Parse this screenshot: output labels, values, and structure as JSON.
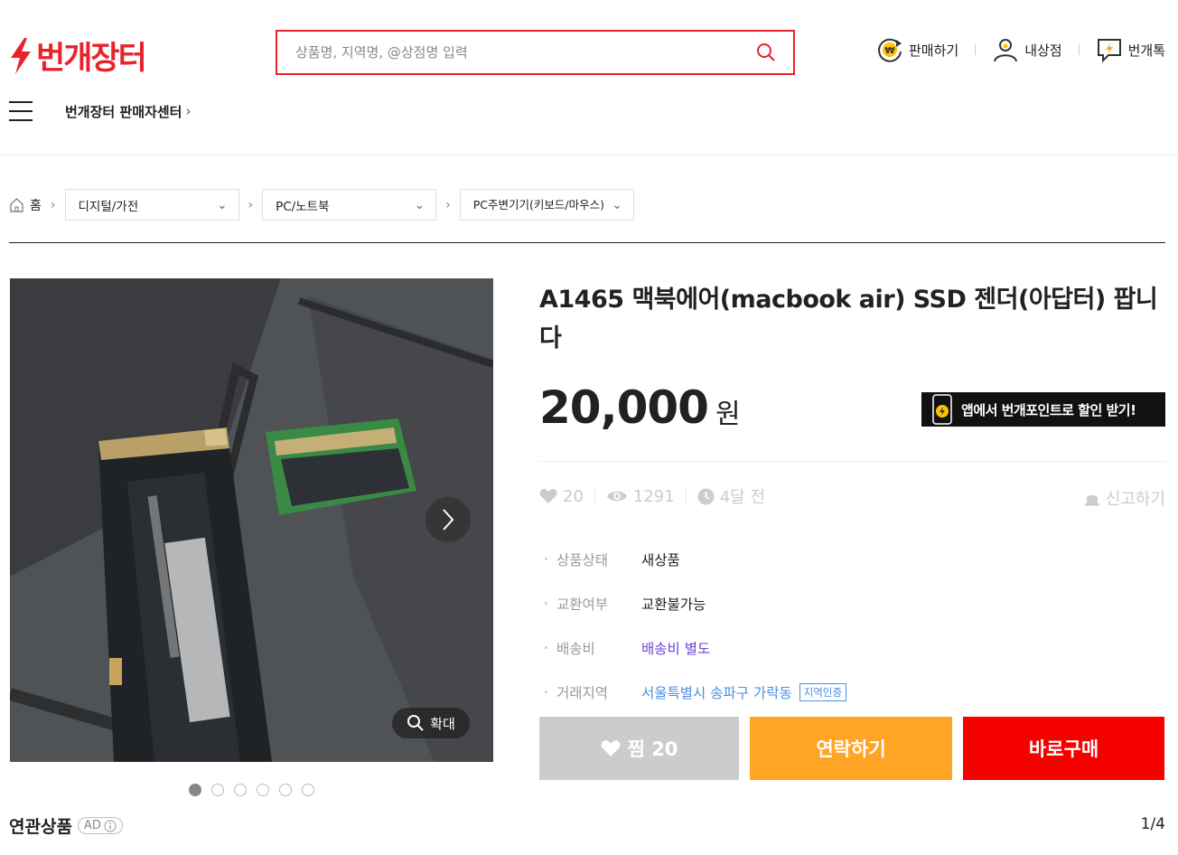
{
  "header": {
    "logo_text": "번개장터",
    "search_placeholder": "상품명, 지역명, @상점명 입력",
    "menu": {
      "sell": "판매하기",
      "my_shop": "내상점",
      "talk": "번개톡"
    },
    "seller_center": "번개장터 판매자센터"
  },
  "breadcrumb": {
    "home": "홈",
    "cat1": "디지털/가전",
    "cat2": "PC/노트북",
    "cat3": "PC주변기기(키보드/마우스)"
  },
  "gallery": {
    "zoom_label": "확대",
    "dot_count": 6,
    "active_dot": 1
  },
  "product": {
    "title": "A1465 맥북에어(macbook air) SSD 젠더(아답터) 팝니다",
    "price": "20,000",
    "price_unit": "원",
    "app_banner": "앱에서 번개포인트로 할인 받기!",
    "likes": "20",
    "views": "1291",
    "time": "4달 전",
    "report": "신고하기",
    "details": {
      "condition_label": "상품상태",
      "condition_value": "새상품",
      "exchange_label": "교환여부",
      "exchange_value": "교환불가능",
      "shipping_label": "배송비",
      "shipping_value": "배송비 별도",
      "location_label": "거래지역",
      "location_value": "서울특별시 송파구 가락동",
      "location_badge": "지역인증"
    }
  },
  "buttons": {
    "like": "찜 20",
    "contact": "연락하기",
    "buy": "바로구매"
  },
  "related": {
    "title": "연관상품",
    "ad": "AD",
    "pager": "1/4"
  },
  "colors": {
    "brand": "#e8232a",
    "contact": "#ffa425",
    "buy": "#f70000",
    "shipping": "#6b45d6",
    "location": "#4a90e2"
  }
}
